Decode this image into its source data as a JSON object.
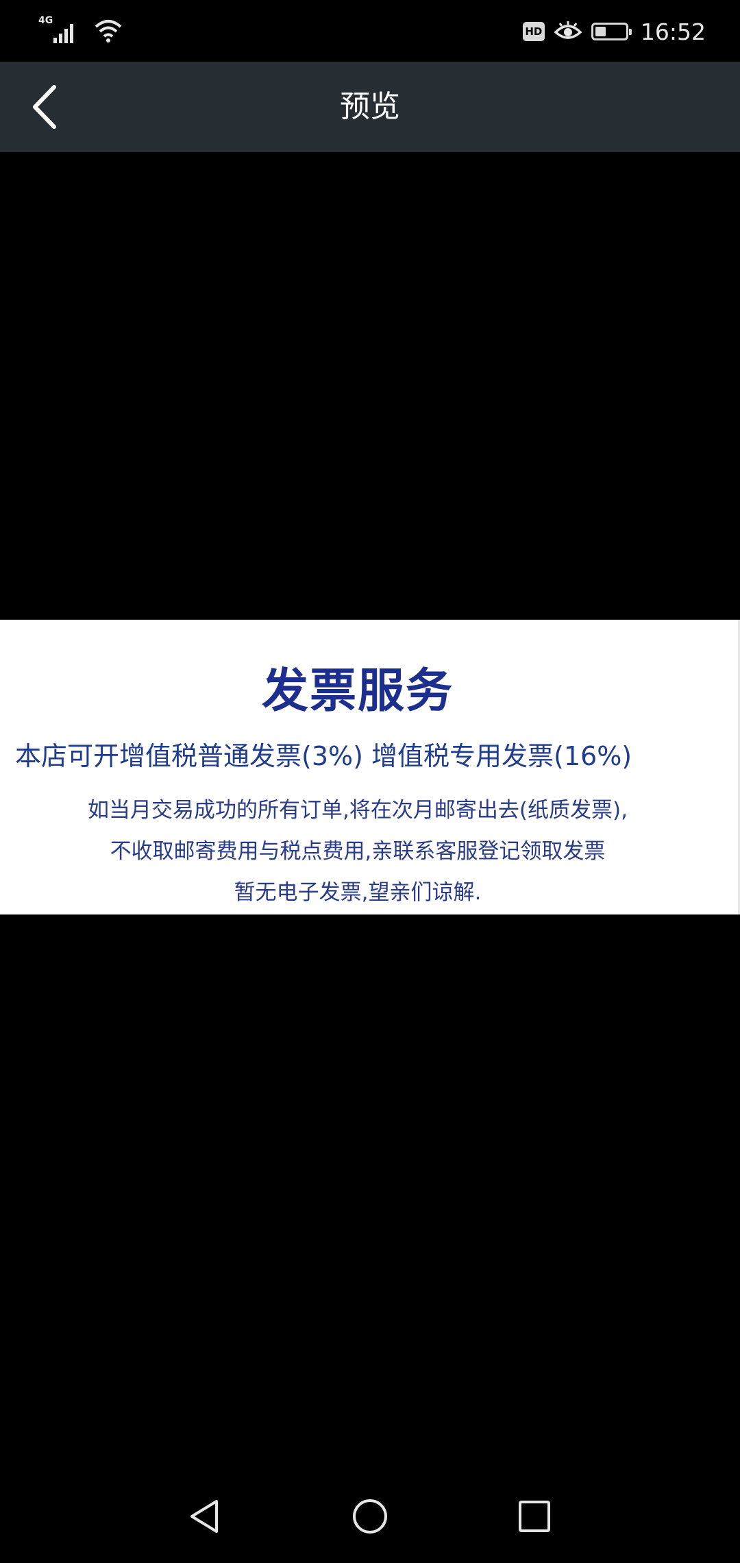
{
  "status_bar": {
    "network_type": "4G",
    "hd_badge": "HD",
    "battery_level": 0.35,
    "time": "16:52"
  },
  "header": {
    "title": "预览",
    "back_icon": "chevron-left-icon"
  },
  "preview": {
    "heading": "发票服务",
    "line_main": "本店可开增值税普通发票(3%) 增值税专用发票(16%)",
    "detail_lines": [
      "如当月交易成功的所有订单,将在次月邮寄出去(纸质发票),",
      "不收取邮寄费用与税点费用,亲联系客服登记领取发票",
      "暂无电子发票,望亲们谅解."
    ]
  },
  "nav_bar": {
    "back_icon": "triangle-back-icon",
    "home_icon": "circle-home-icon",
    "recent_icon": "square-recent-icon"
  },
  "colors": {
    "header_bg": "#262d33",
    "heading_blue": "#1c2f8f",
    "text_blue": "#1f3c8f"
  }
}
